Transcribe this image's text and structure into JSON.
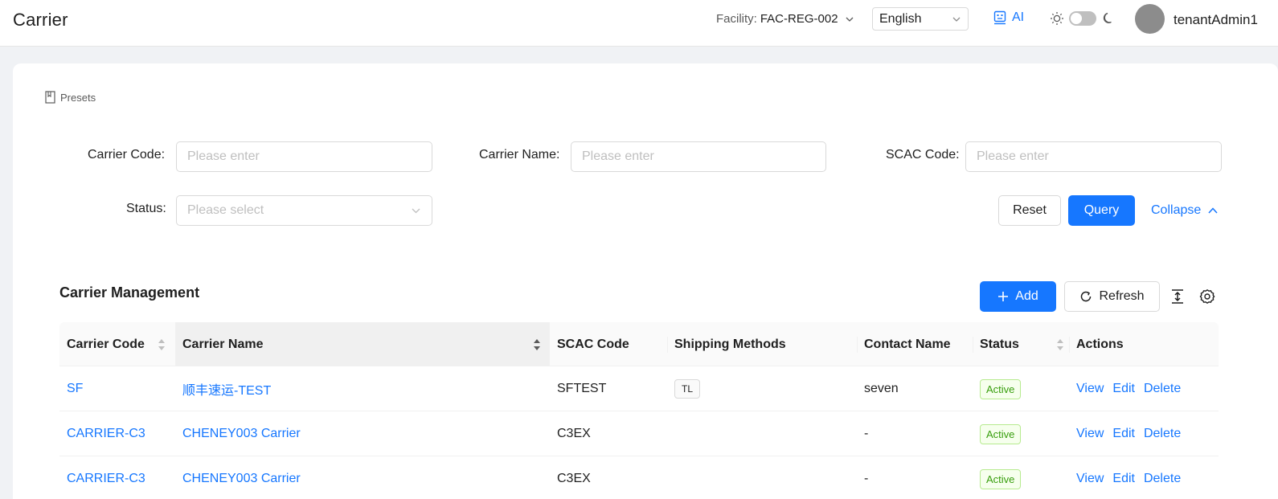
{
  "header": {
    "title": "Carrier",
    "facility_label": "Facility:",
    "facility_value": "FAC-REG-002",
    "language": "English",
    "ai_label": "AI",
    "username": "tenantAdmin1"
  },
  "presets_label": "Presets",
  "filters": {
    "carrier_code": {
      "label": "Carrier Code",
      "placeholder": "Please enter"
    },
    "carrier_name": {
      "label": "Carrier Name",
      "placeholder": "Please enter"
    },
    "scac_code": {
      "label": "SCAC Code",
      "placeholder": "Please enter"
    },
    "status": {
      "label": "Status",
      "placeholder": "Please select"
    },
    "label_suffix": ":"
  },
  "buttons": {
    "reset": "Reset",
    "query": "Query",
    "collapse": "Collapse",
    "add": "Add",
    "refresh": "Refresh"
  },
  "table": {
    "title": "Carrier Management",
    "columns": [
      "Carrier Code",
      "Carrier Name",
      "SCAC Code",
      "Shipping Methods",
      "Contact Name",
      "Status",
      "Actions"
    ],
    "action_labels": {
      "view": "View",
      "edit": "Edit",
      "delete": "Delete"
    },
    "rows": [
      {
        "carrier_code": "SF",
        "carrier_name": "顺丰速运-TEST",
        "scac_code": "SFTEST",
        "shipping_method": "TL",
        "contact_name": "seven",
        "status": "Active"
      },
      {
        "carrier_code": "CARRIER-C3",
        "carrier_name": "CHENEY003 Carrier",
        "scac_code": "C3EX",
        "shipping_method": "",
        "contact_name": "-",
        "status": "Active"
      },
      {
        "carrier_code": "CARRIER-C3",
        "carrier_name": "CHENEY003 Carrier",
        "scac_code": "C3EX",
        "shipping_method": "",
        "contact_name": "-",
        "status": "Active"
      }
    ]
  },
  "colors": {
    "primary": "#1677ff",
    "active_tag_text": "#389e0d",
    "active_tag_bg": "#f6ffed",
    "active_tag_border": "#b7eb8f"
  }
}
